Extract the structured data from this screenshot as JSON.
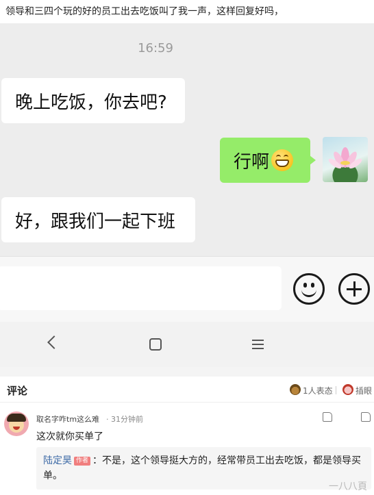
{
  "post": {
    "title": "领导和三四个玩的好的员工出去吃饭叫了我一声，这样回复好吗，"
  },
  "chat": {
    "time": "16:59",
    "messages": [
      {
        "side": "left",
        "text": "晚上吃饭，你去吧?"
      },
      {
        "side": "right",
        "text": "行啊",
        "emoji": "grinning-emoji"
      },
      {
        "side": "left",
        "text": "好，跟我们一起下班"
      }
    ],
    "self_avatar": "lotus-flower-avatar"
  },
  "input_bar": {
    "icons": [
      "emoji-smile-icon",
      "plus-icon"
    ]
  },
  "navbar": {
    "icons": [
      "back-chevron-icon",
      "home-square-icon",
      "menu-lines-icon"
    ]
  },
  "comments": {
    "title": "评论",
    "reactions": [
      {
        "icon": "reaction-face-icon",
        "label": "1人表态"
      },
      {
        "icon": "sticker-icon",
        "label": "插眼"
      }
    ],
    "items": [
      {
        "author": "取名字咋tm这么难",
        "time": "· 31分钟前",
        "text": "这次就你买单了",
        "reply": {
          "author": "陆定昊",
          "badge": "作者",
          "text": "：不是，这个领导挺大方的，经常带员工出去吃饭，都是领导买单。"
        }
      }
    ]
  },
  "watermark": "一八八頁"
}
